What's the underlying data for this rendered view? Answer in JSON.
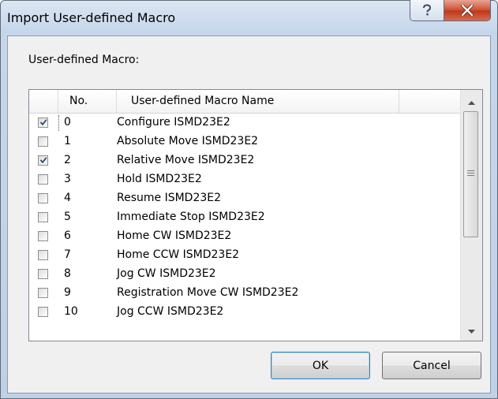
{
  "window": {
    "title": "Import User-defined Macro"
  },
  "group_label": "User-defined Macro:",
  "list": {
    "columns": [
      "No.",
      "User-defined Macro Name"
    ],
    "rows": [
      {
        "no": "0",
        "name": "Configure ISMD23E2",
        "checked": true
      },
      {
        "no": "1",
        "name": "Absolute Move ISMD23E2",
        "checked": false
      },
      {
        "no": "2",
        "name": "Relative Move ISMD23E2",
        "checked": true
      },
      {
        "no": "3",
        "name": "Hold ISMD23E2",
        "checked": false
      },
      {
        "no": "4",
        "name": "Resume ISMD23E2",
        "checked": false
      },
      {
        "no": "5",
        "name": "Immediate Stop ISMD23E2",
        "checked": false
      },
      {
        "no": "6",
        "name": "Home CW ISMD23E2",
        "checked": false
      },
      {
        "no": "7",
        "name": "Home CCW ISMD23E2",
        "checked": false
      },
      {
        "no": "8",
        "name": "Jog CW ISMD23E2",
        "checked": false
      },
      {
        "no": "9",
        "name": "Registration Move CW ISMD23E2",
        "checked": false
      },
      {
        "no": "10",
        "name": "Jog CCW ISMD23E2",
        "checked": false
      }
    ]
  },
  "buttons": {
    "ok": "OK",
    "cancel": "Cancel"
  },
  "icons": {
    "help": "help-icon",
    "close": "close-icon",
    "scroll_up": "chevron-up-icon",
    "scroll_down": "chevron-down-icon"
  },
  "colors": {
    "accent_border": "#3c7fb1",
    "close_red": "#c0391c",
    "checkmark": "#2a4d7a"
  }
}
